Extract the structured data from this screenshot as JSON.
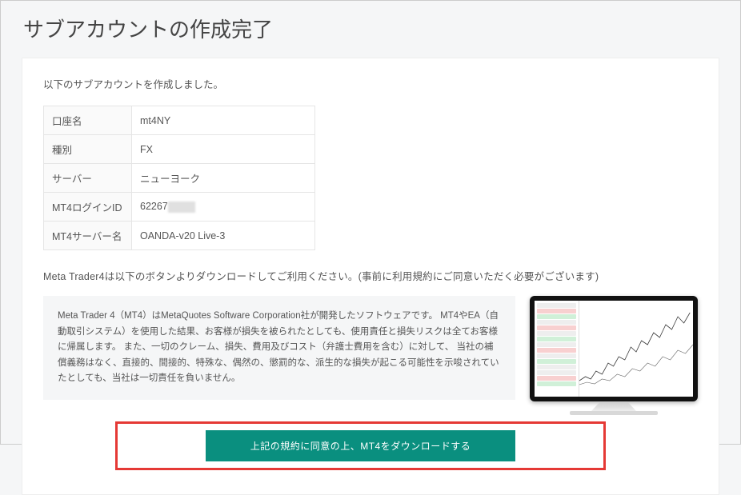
{
  "page_title": "サブアカウントの作成完了",
  "intro": "以下のサブアカウントを作成しました。",
  "table": {
    "rows": [
      {
        "label": "口座名",
        "value": "mt4NY"
      },
      {
        "label": "種別",
        "value": "FX"
      },
      {
        "label": "サーバー",
        "value": "ニューヨーク"
      },
      {
        "label": "MT4ログインID",
        "value": "62267"
      },
      {
        "label": "MT4サーバー名",
        "value": "OANDA-v20 Live-3"
      }
    ]
  },
  "note": "Meta Trader4は以下のボタンよりダウンロードしてご利用ください。(事前に利用規約にご同意いただく必要がございます)",
  "disclaimer": "Meta Trader 4（MT4）はMetaQuotes Software Corporation社が開発したソフトウェアです。\nMT4やEA（自動取引システム）を使用した結果、お客様が損失を被られたとしても、使用責任と損失リスクは全てお客様に帰属します。 また、一切のクレーム、損失、費用及びコスト（弁護士費用を含む）に対して、 当社の補償義務はなく、直接的、間接的、特殊な、偶然の、懲罰的な、派生的な損失が起こる可能性を示唆されていたとしても、当社は一切責任を負いません。",
  "download_button": "上記の規約に同意の上、MT4をダウンロードする"
}
